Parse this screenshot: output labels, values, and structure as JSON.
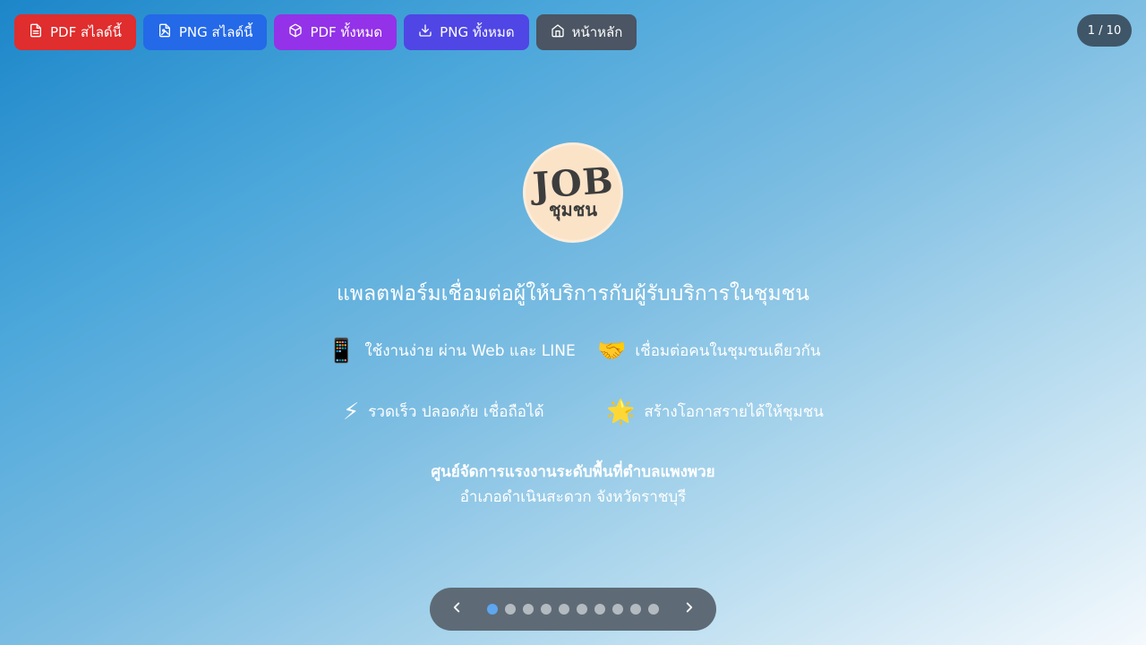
{
  "toolbar": {
    "buttons": [
      {
        "label": "PDF สไลด์นี้",
        "icon": "file-text-icon",
        "color": "#e02d2d"
      },
      {
        "label": "PNG สไลด์นี้",
        "icon": "file-image-icon",
        "color": "#2469e8"
      },
      {
        "label": "PDF ทั้งหมด",
        "icon": "package-icon",
        "color": "#9332e8"
      },
      {
        "label": "PNG ทั้งหมด",
        "icon": "download-icon",
        "color": "#4f46e5"
      },
      {
        "label": "หน้าหลัก",
        "icon": "home-icon",
        "color": "#4b5563"
      }
    ]
  },
  "counter": "1 / 10",
  "slide": {
    "logo": {
      "main": "JOB",
      "sub": "ชุมชน"
    },
    "tagline": "แพลตฟอร์มเชื่อมต่อผู้ให้บริการกับผู้รับบริการในชุมชน",
    "features": [
      {
        "emoji": "📱",
        "text": "ใช้งานง่าย ผ่าน Web และ LINE"
      },
      {
        "emoji": "🤝",
        "text": "เชื่อมต่อคนในชุมชนเดียวกัน"
      },
      {
        "emoji": "⚡",
        "text": "รวดเร็ว ปลอดภัย เชื่อถือได้"
      },
      {
        "emoji": "🌟",
        "text": "สร้างโอกาสรายได้ให้ชุมชน"
      }
    ],
    "org_name": "ศูนย์จัดการแรงงานระดับพื้นที่ตำบลแพงพวย",
    "org_address": "อำเภอดำเนินสะดวก จังหวัดราชบุรี"
  },
  "nav": {
    "total_slides": 10,
    "current_slide": 1,
    "prev_icon": "chevron-left-icon",
    "next_icon": "chevron-right-icon",
    "active_dot_color": "#5ea6ef"
  }
}
